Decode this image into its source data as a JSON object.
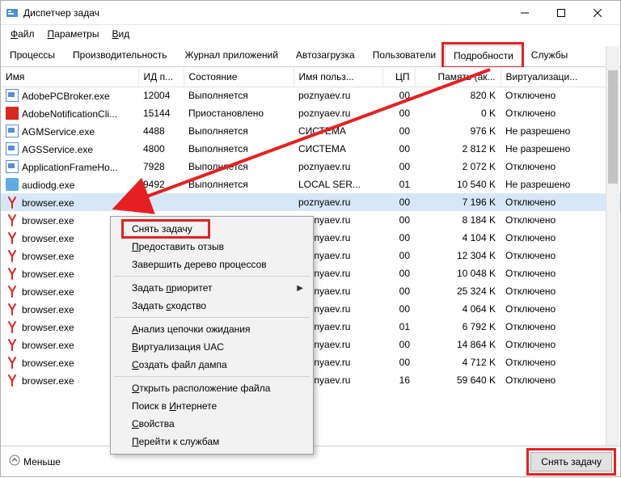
{
  "window": {
    "title": "Диспетчер задач",
    "controls": {
      "min": "—",
      "max": "▢",
      "close": "✕"
    }
  },
  "menubar": [
    {
      "label": "Файл",
      "u": "Ф"
    },
    {
      "label": "Параметры",
      "u": "П"
    },
    {
      "label": "Вид",
      "u": "В"
    }
  ],
  "tabs": [
    {
      "label": "Процессы"
    },
    {
      "label": "Производительность"
    },
    {
      "label": "Журнал приложений"
    },
    {
      "label": "Автозагрузка"
    },
    {
      "label": "Пользователи"
    },
    {
      "label": "Подробности",
      "active": true,
      "highlight": true
    },
    {
      "label": "Службы"
    }
  ],
  "columns": [
    "Имя",
    "ИД п...",
    "Состояние",
    "Имя польз...",
    "ЦП",
    "Память (ак...",
    "Виртуализаци..."
  ],
  "rows": [
    {
      "icon": "generic",
      "name": "AdobePCBroker.exe",
      "pid": "12004",
      "state": "Выполняется",
      "user": "poznyaev.ru",
      "cpu": "00",
      "mem": "820 K",
      "virt": "Отключено"
    },
    {
      "icon": "adobe",
      "name": "AdobeNotificationCli...",
      "pid": "15144",
      "state": "Приостановлено",
      "user": "poznyaev.ru",
      "cpu": "00",
      "mem": "0 K",
      "virt": "Отключено"
    },
    {
      "icon": "generic",
      "name": "AGMService.exe",
      "pid": "4488",
      "state": "Выполняется",
      "user": "СИСТЕМА",
      "cpu": "00",
      "mem": "976 K",
      "virt": "Не разрешено"
    },
    {
      "icon": "generic",
      "name": "AGSService.exe",
      "pid": "4800",
      "state": "Выполняется",
      "user": "СИСТЕМА",
      "cpu": "00",
      "mem": "2 812 K",
      "virt": "Не разрешено"
    },
    {
      "icon": "generic",
      "name": "ApplicationFrameHo...",
      "pid": "7928",
      "state": "Выполняется",
      "user": "poznyaev.ru",
      "cpu": "00",
      "mem": "2 072 K",
      "virt": "Отключено"
    },
    {
      "icon": "audio",
      "name": "audiodg.exe",
      "pid": "9492",
      "state": "Выполняется",
      "user": "LOCAL SER...",
      "cpu": "01",
      "mem": "10 540 K",
      "virt": "Не разрешено"
    },
    {
      "icon": "yandex",
      "name": "browser.exe",
      "pid": "",
      "state": "",
      "user": "poznyaev.ru",
      "cpu": "00",
      "mem": "7 196 K",
      "virt": "Отключено",
      "selected": true
    },
    {
      "icon": "yandex",
      "name": "browser.exe",
      "pid": "",
      "state": "",
      "user": "poznyaev.ru",
      "cpu": "00",
      "mem": "8 184 K",
      "virt": "Отключено"
    },
    {
      "icon": "yandex",
      "name": "browser.exe",
      "pid": "",
      "state": "",
      "user": "poznyaev.ru",
      "cpu": "00",
      "mem": "4 104 K",
      "virt": "Отключено"
    },
    {
      "icon": "yandex",
      "name": "browser.exe",
      "pid": "",
      "state": "",
      "user": "poznyaev.ru",
      "cpu": "00",
      "mem": "12 304 K",
      "virt": "Отключено"
    },
    {
      "icon": "yandex",
      "name": "browser.exe",
      "pid": "",
      "state": "",
      "user": "poznyaev.ru",
      "cpu": "00",
      "mem": "10 048 K",
      "virt": "Отключено"
    },
    {
      "icon": "yandex",
      "name": "browser.exe",
      "pid": "",
      "state": "",
      "user": "poznyaev.ru",
      "cpu": "00",
      "mem": "25 324 K",
      "virt": "Отключено"
    },
    {
      "icon": "yandex",
      "name": "browser.exe",
      "pid": "",
      "state": "",
      "user": "poznyaev.ru",
      "cpu": "00",
      "mem": "4 064 K",
      "virt": "Отключено"
    },
    {
      "icon": "yandex",
      "name": "browser.exe",
      "pid": "",
      "state": "",
      "user": "poznyaev.ru",
      "cpu": "01",
      "mem": "6 792 K",
      "virt": "Отключено"
    },
    {
      "icon": "yandex",
      "name": "browser.exe",
      "pid": "",
      "state": "",
      "user": "poznyaev.ru",
      "cpu": "00",
      "mem": "14 864 K",
      "virt": "Отключено"
    },
    {
      "icon": "yandex",
      "name": "browser.exe",
      "pid": "",
      "state": "",
      "user": "poznyaev.ru",
      "cpu": "00",
      "mem": "4 712 K",
      "virt": "Отключено"
    },
    {
      "icon": "yandex",
      "name": "browser.exe",
      "pid": "",
      "state": "",
      "user": "poznyaev.ru",
      "cpu": "16",
      "mem": "59 640 K",
      "virt": "Отключено"
    }
  ],
  "context_menu": [
    {
      "label": "Снять задачу",
      "highlight": true
    },
    {
      "label": "Предоставить отзыв",
      "u": "П"
    },
    {
      "label": "Завершить дерево процессов",
      "u": "д"
    },
    {
      "sep": true
    },
    {
      "label": "Задать приоритет",
      "u": "п",
      "submenu": true
    },
    {
      "label": "Задать сходство",
      "u": "с"
    },
    {
      "sep": true
    },
    {
      "label": "Анализ цепочки ожидания",
      "u": "А"
    },
    {
      "label": "Виртуализация UAC",
      "u": "В"
    },
    {
      "label": "Создать файл дампа",
      "u": "С"
    },
    {
      "sep": true
    },
    {
      "label": "Открыть расположение файла",
      "u": "О"
    },
    {
      "label": "Поиск в Интернете",
      "u": "И"
    },
    {
      "label": "Свойства",
      "u": "С"
    },
    {
      "label": "Перейти к службам",
      "u": "П"
    }
  ],
  "bottom": {
    "fewer": "Меньше",
    "end_task": "Снять задачу"
  }
}
